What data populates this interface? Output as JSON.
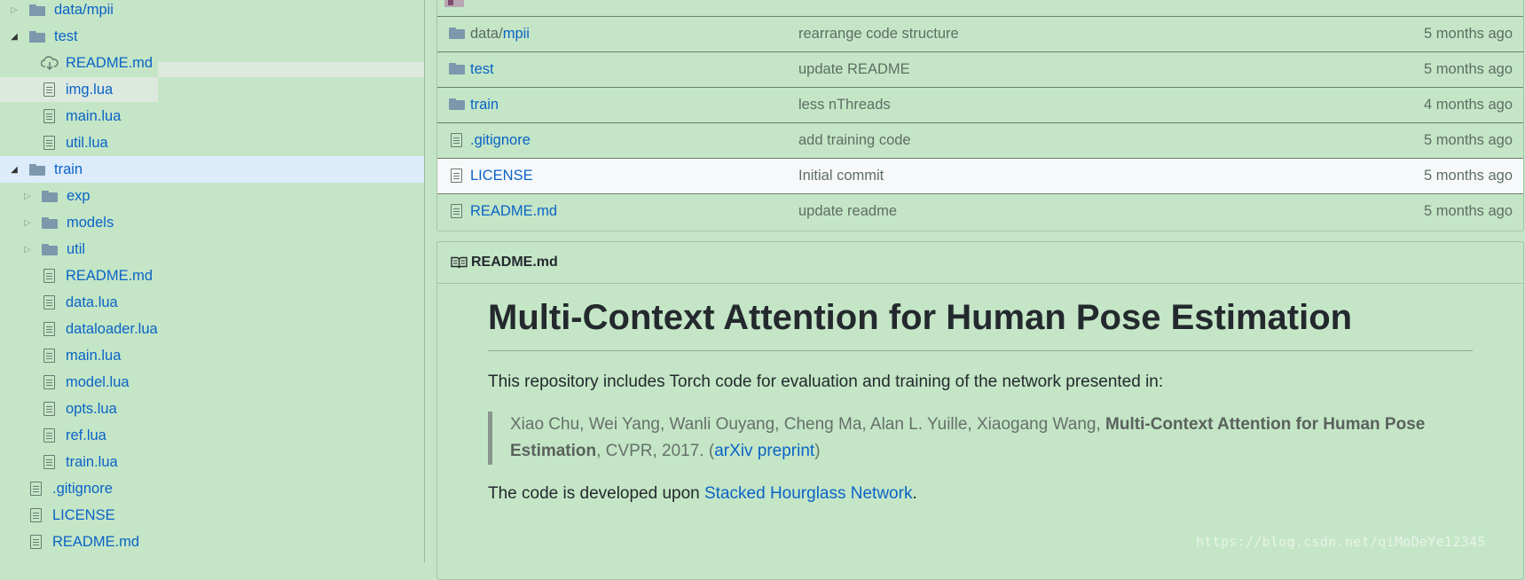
{
  "tree": {
    "items": [
      {
        "label": "data/mpii",
        "type": "folder",
        "expanded": false
      },
      {
        "label": "test",
        "type": "folder",
        "expanded": true
      },
      {
        "label": "README.md",
        "type": "cloud-file"
      },
      {
        "label": "img.lua",
        "type": "file"
      },
      {
        "label": "main.lua",
        "type": "file"
      },
      {
        "label": "util.lua",
        "type": "file"
      },
      {
        "label": "train",
        "type": "folder",
        "expanded": true,
        "selected": true
      },
      {
        "label": "exp",
        "type": "folder",
        "expanded": false
      },
      {
        "label": "models",
        "type": "folder",
        "expanded": false
      },
      {
        "label": "util",
        "type": "folder",
        "expanded": false
      },
      {
        "label": "README.md",
        "type": "file"
      },
      {
        "label": "data.lua",
        "type": "file"
      },
      {
        "label": "dataloader.lua",
        "type": "file"
      },
      {
        "label": "main.lua",
        "type": "file"
      },
      {
        "label": "model.lua",
        "type": "file"
      },
      {
        "label": "opts.lua",
        "type": "file"
      },
      {
        "label": "ref.lua",
        "type": "file"
      },
      {
        "label": "train.lua",
        "type": "file"
      },
      {
        "label": ".gitignore",
        "type": "file"
      },
      {
        "label": "LICENSE",
        "type": "file"
      },
      {
        "label": "README.md",
        "type": "file"
      }
    ]
  },
  "files": {
    "rows": [
      {
        "name_prefix": "data/",
        "name": "mpii",
        "type": "folder",
        "message": "rearrange code structure",
        "age": "5 months ago"
      },
      {
        "name_prefix": "",
        "name": "test",
        "type": "folder",
        "message": "update README",
        "age": "5 months ago"
      },
      {
        "name_prefix": "",
        "name": "train",
        "type": "folder",
        "message": "less nThreads",
        "age": "4 months ago"
      },
      {
        "name_prefix": "",
        "name": ".gitignore",
        "type": "file",
        "message": "add training code",
        "age": "5 months ago"
      },
      {
        "name_prefix": "",
        "name": "LICENSE",
        "type": "file",
        "message": "Initial commit",
        "age": "5 months ago"
      },
      {
        "name_prefix": "",
        "name": "README.md",
        "type": "file",
        "message": "update readme",
        "age": "5 months ago"
      }
    ]
  },
  "readme": {
    "header": "README.md",
    "title": "Multi-Context Attention for Human Pose Estimation",
    "intro": "This repository includes Torch code for evaluation and training of the network presented in:",
    "quote_authors": "Xiao Chu, Wei Yang, Wanli Ouyang, Cheng Ma, Alan L. Yuille, Xiaogang Wang, ",
    "quote_title": "Multi-Context Attention for Human Pose Estimation",
    "quote_venue": ", CVPR, 2017. (",
    "quote_link": "arXiv preprint",
    "quote_close": ")",
    "dev_prefix": "The code is developed upon ",
    "dev_link": "Stacked Hourglass Network",
    "dev_suffix": "."
  },
  "watermark": "https://blog.csdn.net/qiMoDeYe12345",
  "colors": {
    "background": "#c4e6c6",
    "link": "#0b63c7",
    "selected_row": "#dcecfb",
    "hover_row": "#f6f8fa"
  }
}
